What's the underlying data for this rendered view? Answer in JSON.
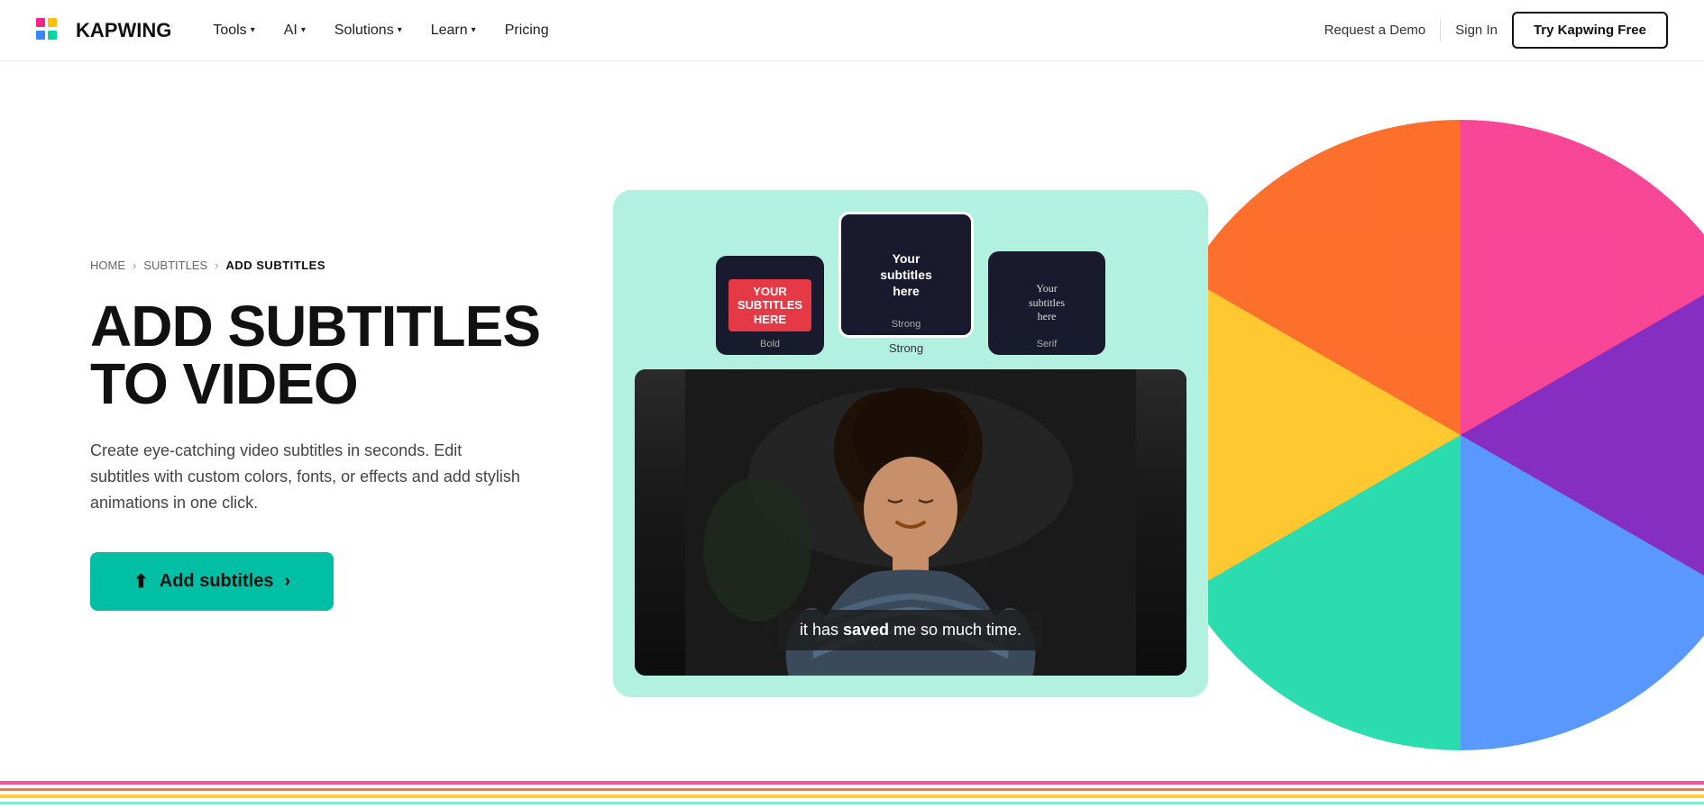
{
  "logo": {
    "text": "KAPWING",
    "colors": [
      "#f72585",
      "#ffbe0b",
      "#3a86ff",
      "#06d6a0"
    ]
  },
  "nav": {
    "links": [
      {
        "label": "Tools",
        "has_dropdown": true
      },
      {
        "label": "AI",
        "has_dropdown": true
      },
      {
        "label": "Solutions",
        "has_dropdown": true
      },
      {
        "label": "Learn",
        "has_dropdown": true
      },
      {
        "label": "Pricing",
        "has_dropdown": false
      }
    ],
    "request_demo": "Request a Demo",
    "sign_in": "Sign In",
    "try_free": "Try Kapwing Free"
  },
  "breadcrumb": {
    "home": "HOME",
    "subtitles": "SUBTITLES",
    "current": "ADD SUBTITLES"
  },
  "hero": {
    "title_line1": "ADD SUBTITLES",
    "title_line2": "TO VIDEO",
    "description": "Create eye-catching video subtitles in seconds. Edit subtitles with custom colors, fonts, or effects and add stylish animations in one click.",
    "cta_label": "Add subtitles"
  },
  "style_cards": [
    {
      "id": "bold",
      "label": "Bold",
      "text": "Your subtitles here",
      "style": "bold"
    },
    {
      "id": "strong",
      "label": "Strong",
      "text": "Your subtitles here",
      "style": "strong"
    },
    {
      "id": "serif",
      "label": "Serif",
      "text": "Your subtitles here",
      "style": "serif"
    }
  ],
  "video_subtitle": {
    "text_before": "it has ",
    "text_bold": "saved",
    "text_after": " me so much time."
  },
  "accent_color": "#00bfa5"
}
